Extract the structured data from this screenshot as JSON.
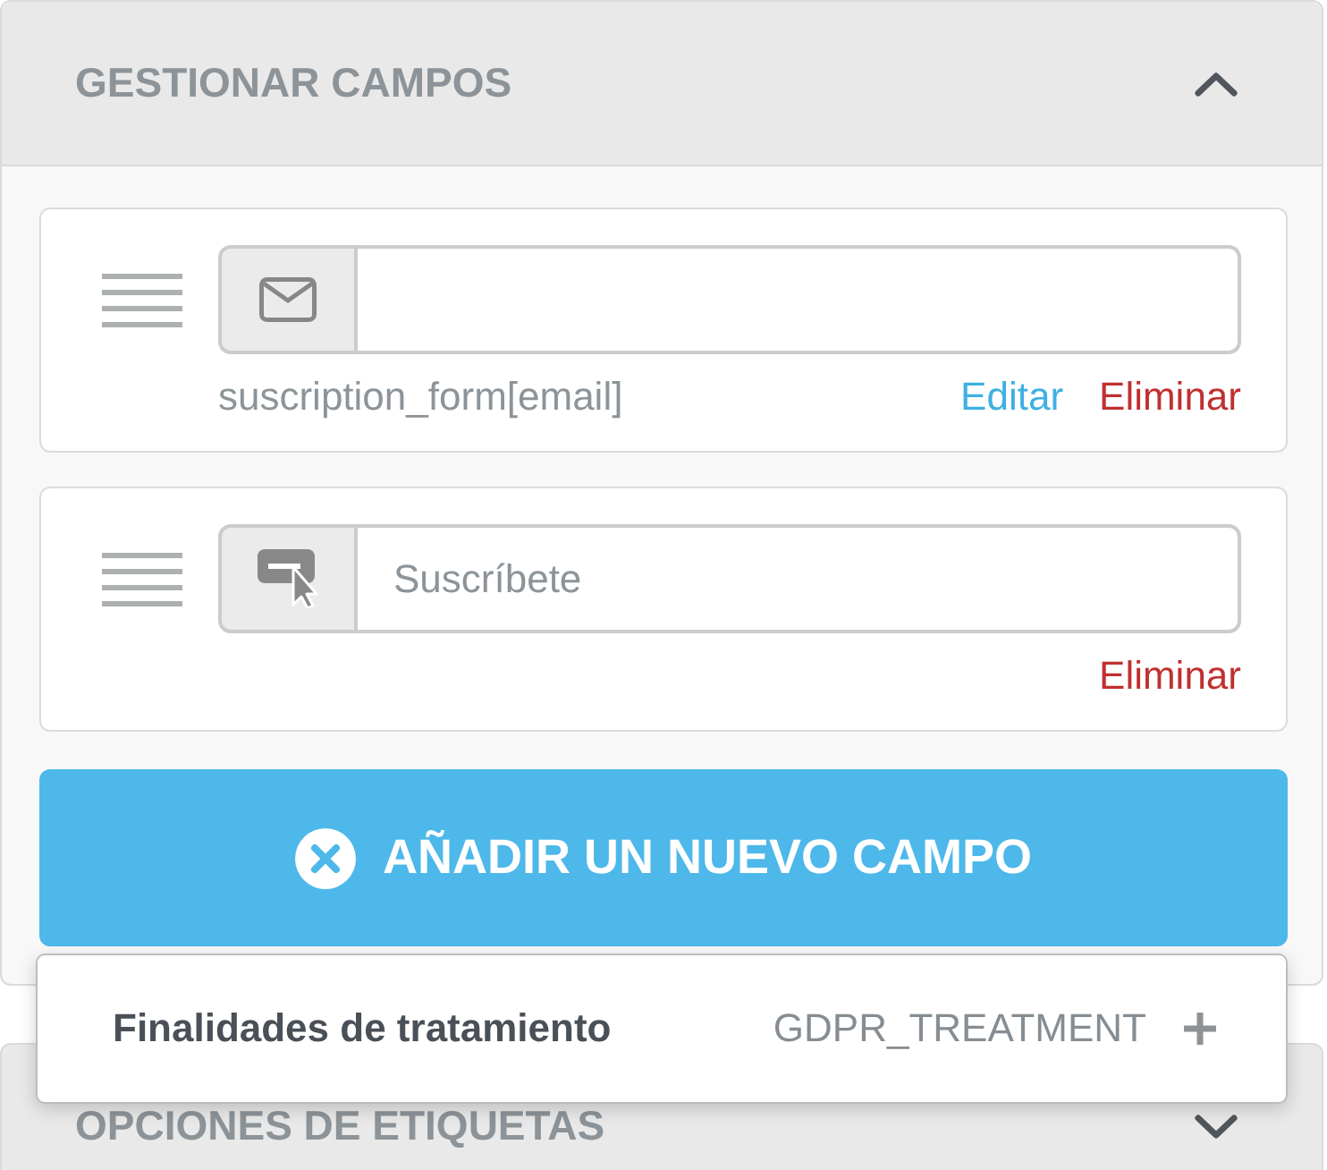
{
  "panels": [
    {
      "title": "GESTIONAR CAMPOS",
      "expanded": true,
      "fields": [
        {
          "kind": "email",
          "key": "suscription_form[email]",
          "actions": [
            {
              "kind": "edit",
              "label": "Editar"
            },
            {
              "kind": "delete",
              "label": "Eliminar"
            }
          ]
        },
        {
          "kind": "submit",
          "placeholder": "Suscríbete",
          "actions": [
            {
              "kind": "delete",
              "label": "Eliminar"
            }
          ]
        }
      ],
      "add_button": {
        "label": "AÑADIR UN NUEVO CAMPO"
      },
      "add_menu": {
        "items": [
          {
            "label": "Finalidades de tratamiento",
            "code": "GDPR_TREATMENT"
          }
        ]
      }
    },
    {
      "title": "OPCIONES DE ETIQUETAS",
      "expanded": false
    }
  ]
}
